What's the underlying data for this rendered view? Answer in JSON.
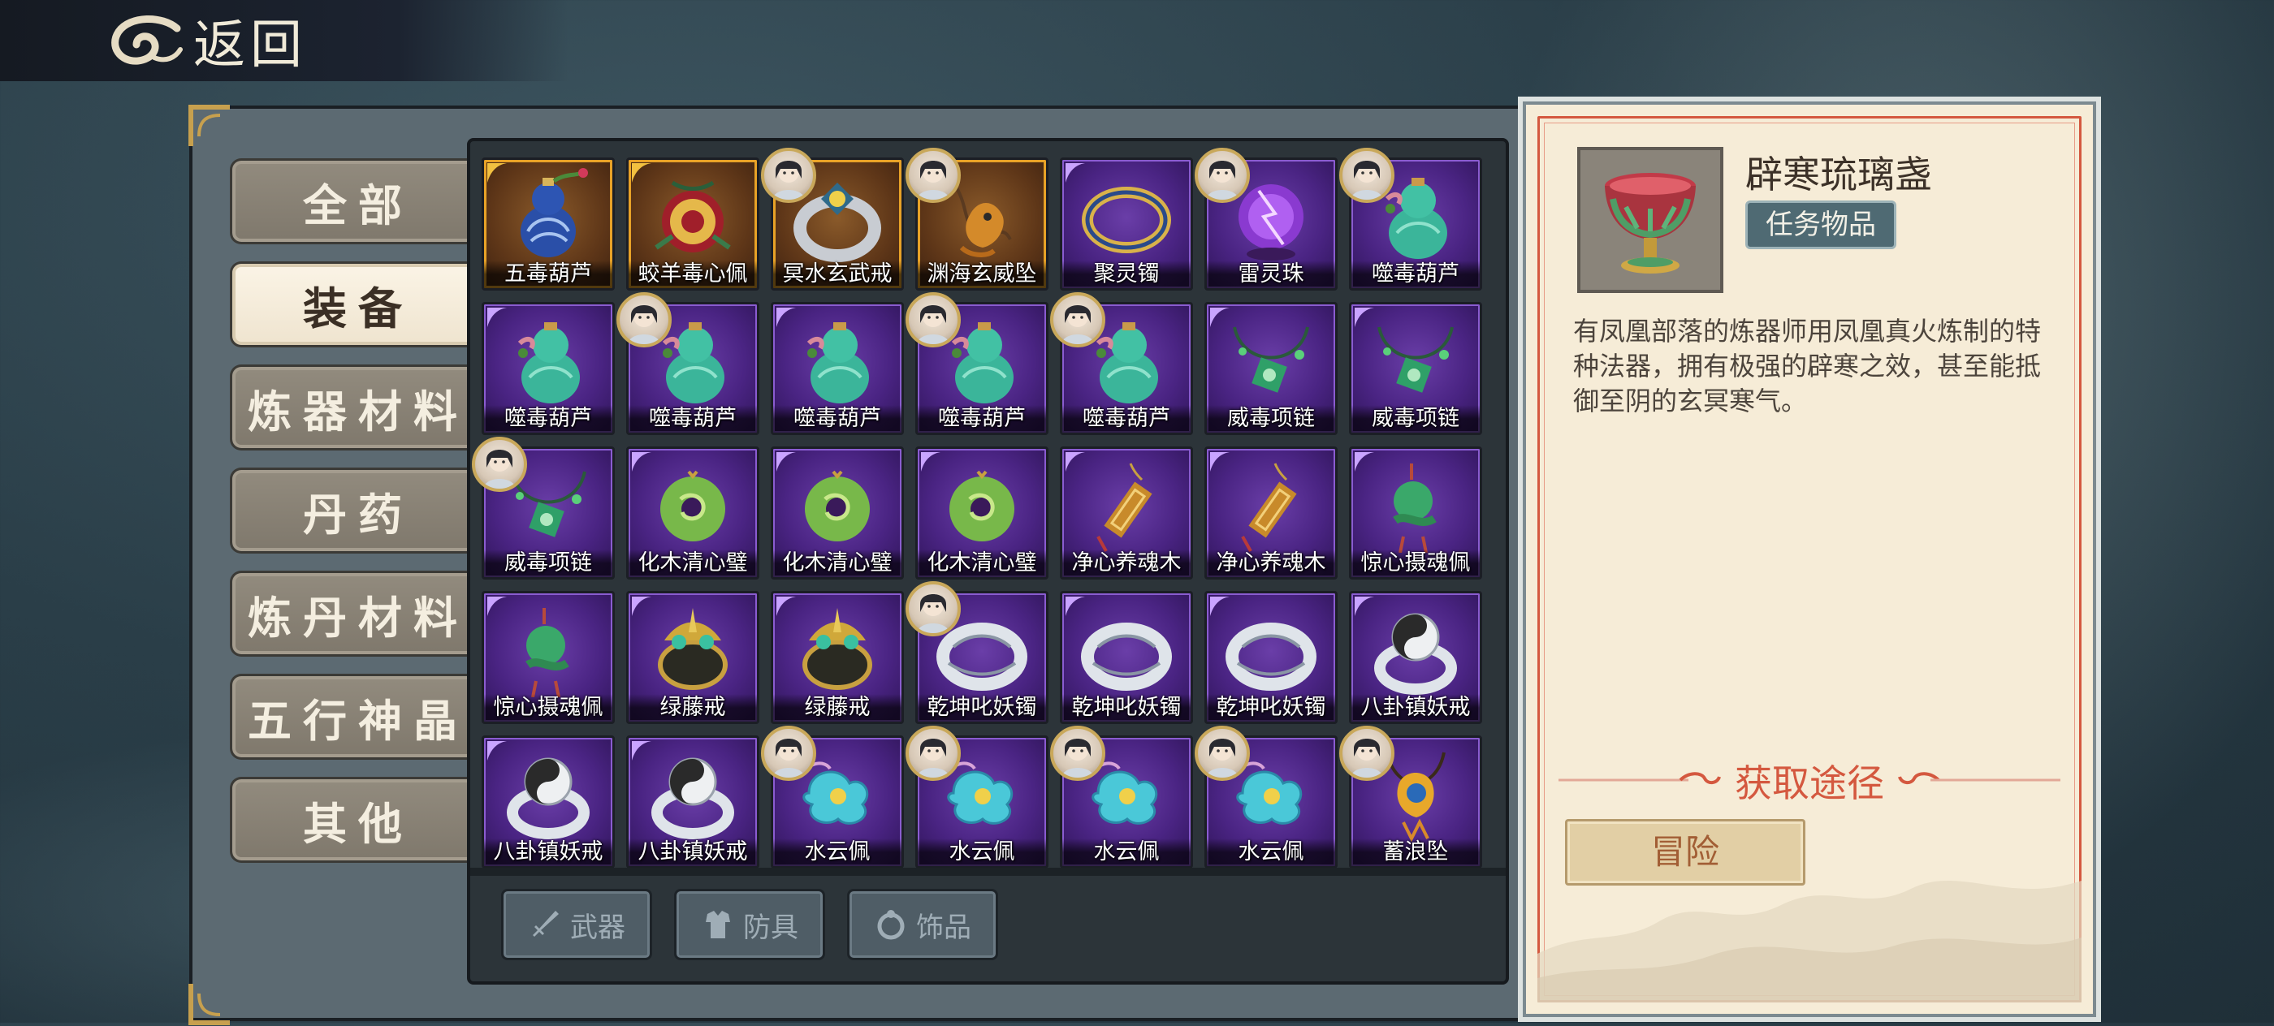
{
  "header": {
    "back_label": "返回"
  },
  "categories": [
    {
      "label": "全部",
      "active": false
    },
    {
      "label": "装备",
      "active": true
    },
    {
      "label": "炼器材料",
      "active": false
    },
    {
      "label": "丹药",
      "active": false
    },
    {
      "label": "炼丹材料",
      "active": false
    },
    {
      "label": "五行神晶",
      "active": false
    },
    {
      "label": "其他",
      "active": false
    }
  ],
  "items": [
    {
      "name": "五毒葫芦",
      "rarity": "gold",
      "icon": "gourd-blue-icon",
      "avatar": false
    },
    {
      "name": "蛟羊毒心佩",
      "rarity": "gold",
      "icon": "pendant-red-icon",
      "avatar": false
    },
    {
      "name": "冥水玄武戒",
      "rarity": "gold",
      "icon": "ring-silver-icon",
      "avatar": true
    },
    {
      "name": "渊海玄威坠",
      "rarity": "gold",
      "icon": "dragon-pendant-icon",
      "avatar": true
    },
    {
      "name": "聚灵镯",
      "rarity": "purple",
      "icon": "bracelet-gold-icon",
      "avatar": false
    },
    {
      "name": "雷灵珠",
      "rarity": "purple",
      "icon": "thunder-orb-icon",
      "avatar": true
    },
    {
      "name": "噬毒葫芦",
      "rarity": "purple",
      "icon": "gourd-green-icon",
      "avatar": true
    },
    {
      "name": "噬毒葫芦",
      "rarity": "purple",
      "icon": "gourd-green-icon",
      "avatar": false
    },
    {
      "name": "噬毒葫芦",
      "rarity": "purple",
      "icon": "gourd-green-icon",
      "avatar": true
    },
    {
      "name": "噬毒葫芦",
      "rarity": "purple",
      "icon": "gourd-green-icon",
      "avatar": false
    },
    {
      "name": "噬毒葫芦",
      "rarity": "purple",
      "icon": "gourd-green-icon",
      "avatar": true
    },
    {
      "name": "噬毒葫芦",
      "rarity": "purple",
      "icon": "gourd-green-icon",
      "avatar": true
    },
    {
      "name": "威毒项链",
      "rarity": "purple",
      "icon": "necklace-green-icon",
      "avatar": false
    },
    {
      "name": "威毒项链",
      "rarity": "purple",
      "icon": "necklace-green-icon",
      "avatar": false
    },
    {
      "name": "威毒项链",
      "rarity": "purple",
      "icon": "necklace-green-icon",
      "avatar": true
    },
    {
      "name": "化木清心璧",
      "rarity": "purple",
      "icon": "jade-disc-icon",
      "avatar": false
    },
    {
      "name": "化木清心璧",
      "rarity": "purple",
      "icon": "jade-disc-icon",
      "avatar": false
    },
    {
      "name": "化木清心璧",
      "rarity": "purple",
      "icon": "jade-disc-icon",
      "avatar": false
    },
    {
      "name": "净心养魂木",
      "rarity": "purple",
      "icon": "wood-token-icon",
      "avatar": false
    },
    {
      "name": "净心养魂木",
      "rarity": "purple",
      "icon": "wood-token-icon",
      "avatar": false
    },
    {
      "name": "惊心摄魂佩",
      "rarity": "purple",
      "icon": "jade-pendant-icon",
      "avatar": false
    },
    {
      "name": "惊心摄魂佩",
      "rarity": "purple",
      "icon": "jade-pendant-icon",
      "avatar": false
    },
    {
      "name": "绿藤戒",
      "rarity": "purple",
      "icon": "vine-ring-icon",
      "avatar": false
    },
    {
      "name": "绿藤戒",
      "rarity": "purple",
      "icon": "vine-ring-icon",
      "avatar": false
    },
    {
      "name": "乾坤叱妖镯",
      "rarity": "purple",
      "icon": "silver-bracelet-icon",
      "avatar": true
    },
    {
      "name": "乾坤叱妖镯",
      "rarity": "purple",
      "icon": "silver-bracelet-icon",
      "avatar": false
    },
    {
      "name": "乾坤叱妖镯",
      "rarity": "purple",
      "icon": "silver-bracelet-icon",
      "avatar": false
    },
    {
      "name": "八卦镇妖戒",
      "rarity": "purple",
      "icon": "bagua-ring-icon",
      "avatar": false
    },
    {
      "name": "八卦镇妖戒",
      "rarity": "purple",
      "icon": "bagua-ring-icon",
      "avatar": false
    },
    {
      "name": "八卦镇妖戒",
      "rarity": "purple",
      "icon": "bagua-ring-icon",
      "avatar": false
    },
    {
      "name": "水云佩",
      "rarity": "purple",
      "icon": "cloud-pendant-icon",
      "avatar": true
    },
    {
      "name": "水云佩",
      "rarity": "purple",
      "icon": "cloud-pendant-icon",
      "avatar": true
    },
    {
      "name": "水云佩",
      "rarity": "purple",
      "icon": "cloud-pendant-icon",
      "avatar": true
    },
    {
      "name": "水云佩",
      "rarity": "purple",
      "icon": "cloud-pendant-icon",
      "avatar": true
    },
    {
      "name": "蓄浪坠",
      "rarity": "purple",
      "icon": "wave-pendant-icon",
      "avatar": true
    }
  ],
  "type_filters": [
    {
      "label": "武器",
      "icon": "sword-icon"
    },
    {
      "label": "防具",
      "icon": "armor-icon"
    },
    {
      "label": "饰品",
      "icon": "ring-icon"
    }
  ],
  "detail": {
    "name": "辟寒琉璃盏",
    "tag": "任务物品",
    "icon": "goblet-icon",
    "description": "有凤凰部落的炼器师用凤凰真火炼制的特种法器，拥有极强的辟寒之效，甚至能抵御至阴的玄冥寒气。",
    "source_title": "获取途径",
    "source_button": "冒险"
  },
  "colors": {
    "accent_red": "#d4583f",
    "purple_frame": "#6a3ea8",
    "gold_frame": "#e8a227",
    "panel_bg": "#f6ecd7"
  }
}
